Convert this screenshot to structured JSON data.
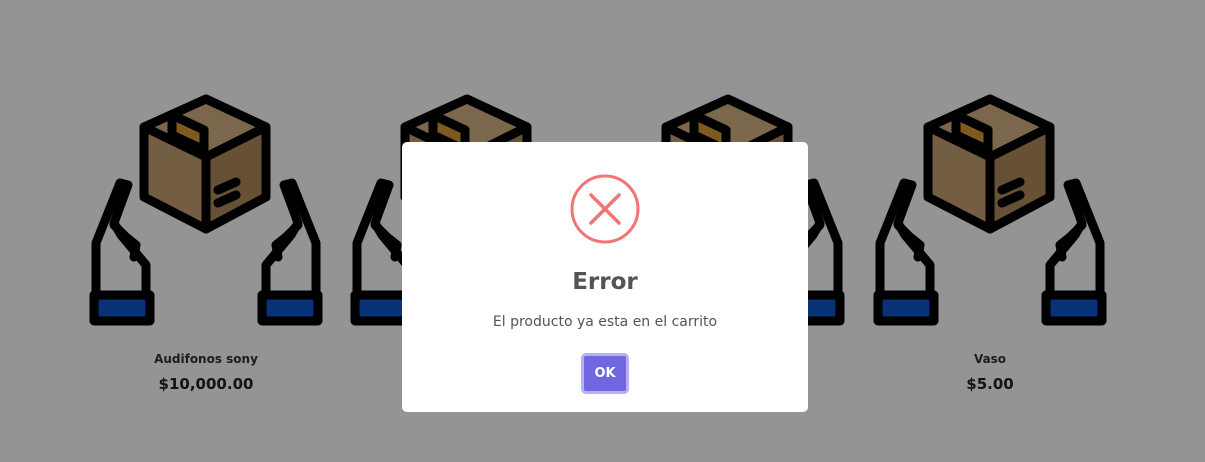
{
  "products": [
    {
      "name": "Audifonos sony",
      "price": "$10,000.00",
      "image_icon": "package-in-hands-icon"
    },
    {
      "name": "",
      "price": "",
      "image_icon": "package-in-hands-icon"
    },
    {
      "name": "",
      "price": "",
      "image_icon": "package-in-hands-icon"
    },
    {
      "name": "Vaso",
      "price": "$5.00",
      "image_icon": "package-in-hands-icon"
    }
  ],
  "modal": {
    "title": "Error",
    "text": "El producto ya esta en el carrito",
    "confirm_label": "OK",
    "icon": "error-x-icon"
  },
  "colors": {
    "box": "#c8a374",
    "box_tape": "#d99a3a",
    "cuff": "#1155cc",
    "error": "#f27474",
    "confirm": "#7066e0",
    "overlay": "rgba(0,0,0,0.42)"
  }
}
